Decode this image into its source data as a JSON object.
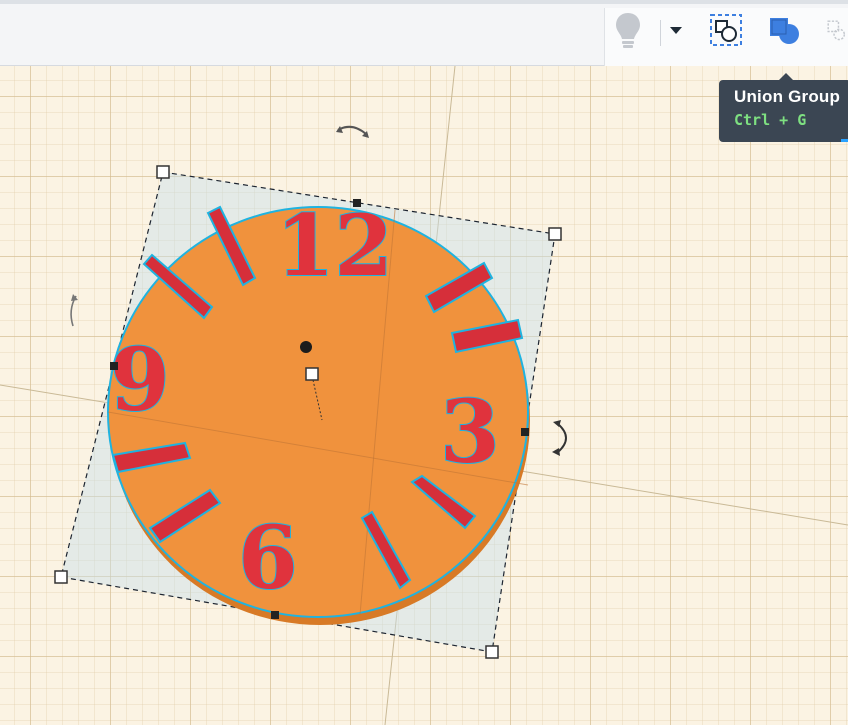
{
  "toolbar": {
    "tools": [
      {
        "name": "show-hide-light",
        "icon": "lightbulb-icon"
      },
      {
        "name": "visibility-dropdown",
        "icon": "caret-down-icon"
      },
      {
        "name": "group",
        "icon": "group-select-icon"
      },
      {
        "name": "union-group",
        "icon": "union-group-icon"
      },
      {
        "name": "ungroup",
        "icon": "ungroup-icon"
      }
    ]
  },
  "tooltip": {
    "title": "Union Group",
    "shortcut": "Ctrl + G"
  },
  "clock": {
    "numerals": {
      "twelve": "12",
      "three": "3",
      "six": "6",
      "nine": "9"
    }
  },
  "colors": {
    "clock_face": "#f0923d",
    "clock_edge": "#d87a26",
    "numerals": "#e0333d",
    "selection_outline": "#1fb3e0",
    "tooltip_bg": "#3b4653",
    "tooltip_shortcut": "#7ee081",
    "union_icon": "#3d7fe0"
  }
}
